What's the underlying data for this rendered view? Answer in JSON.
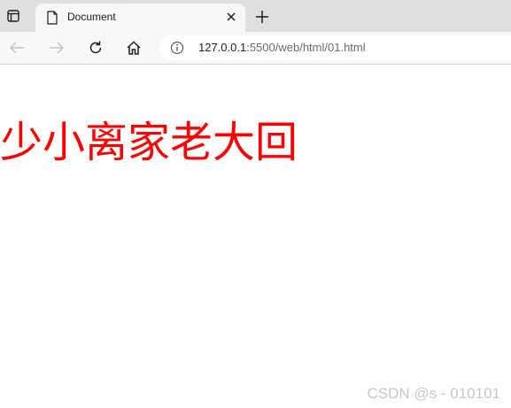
{
  "browser": {
    "tab": {
      "title": "Document",
      "icon": "document-icon"
    },
    "toolbar": {
      "back_icon": "arrow-left-icon",
      "forward_icon": "arrow-right-icon",
      "reload_icon": "reload-icon",
      "home_icon": "home-icon"
    },
    "address": {
      "info_icon": "info-icon",
      "url_host": "127.0.0.1",
      "url_rest": ":5500/web/html/01.html"
    }
  },
  "page": {
    "heading": "少小离家老大回",
    "heading_color": "#ff0000"
  },
  "watermark": "CSDN @s - 010101"
}
